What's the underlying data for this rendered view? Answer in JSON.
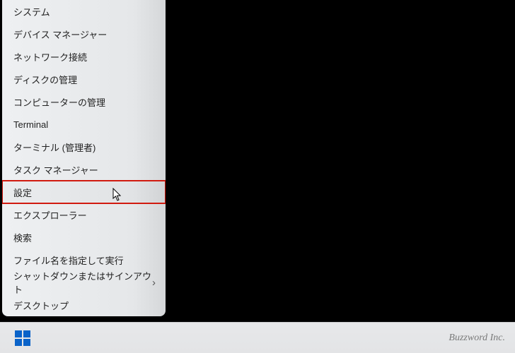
{
  "menu": {
    "items": [
      {
        "label": "システム",
        "has_sub": false
      },
      {
        "label": "デバイス マネージャー",
        "has_sub": false
      },
      {
        "label": "ネットワーク接続",
        "has_sub": false
      },
      {
        "label": "ディスクの管理",
        "has_sub": false
      },
      {
        "label": "コンピューターの管理",
        "has_sub": false
      },
      {
        "label": "Terminal",
        "has_sub": false
      },
      {
        "label": "ターミナル (管理者)",
        "has_sub": false
      },
      {
        "label": "タスク マネージャー",
        "has_sub": false
      },
      {
        "label": "設定",
        "has_sub": false,
        "highlighted": true
      },
      {
        "label": "エクスプローラー",
        "has_sub": false
      },
      {
        "label": "検索",
        "has_sub": false
      },
      {
        "label": "ファイル名を指定して実行",
        "has_sub": false
      },
      {
        "label": "シャットダウンまたはサインアウト",
        "has_sub": true
      },
      {
        "label": "デスクトップ",
        "has_sub": false
      }
    ]
  },
  "taskbar": {
    "brand": "Buzzword Inc."
  }
}
